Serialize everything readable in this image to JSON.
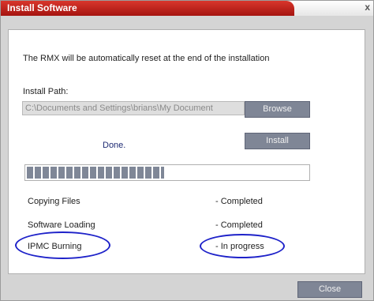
{
  "window": {
    "title": "Install Software",
    "close_glyph": "x"
  },
  "content": {
    "message": "The RMX will be automatically reset at the end of the installation",
    "install_path_label": "Install Path:",
    "install_path_value": "C:\\Documents and Settings\\brians\\My Document",
    "browse_label": "Browse",
    "install_label": "Install",
    "status_text": "Done.",
    "progress_fraction": 0.49
  },
  "steps": [
    {
      "name": "Copying Files",
      "status": "- Completed"
    },
    {
      "name": "Software Loading",
      "status": "- Completed"
    },
    {
      "name": "IPMC Burning",
      "status": "- In progress"
    }
  ],
  "footer": {
    "close_label": "Close"
  },
  "colors": {
    "title_red": "#c0221c",
    "button_gray": "#7f8696",
    "annotation_blue": "#1e22c9"
  }
}
